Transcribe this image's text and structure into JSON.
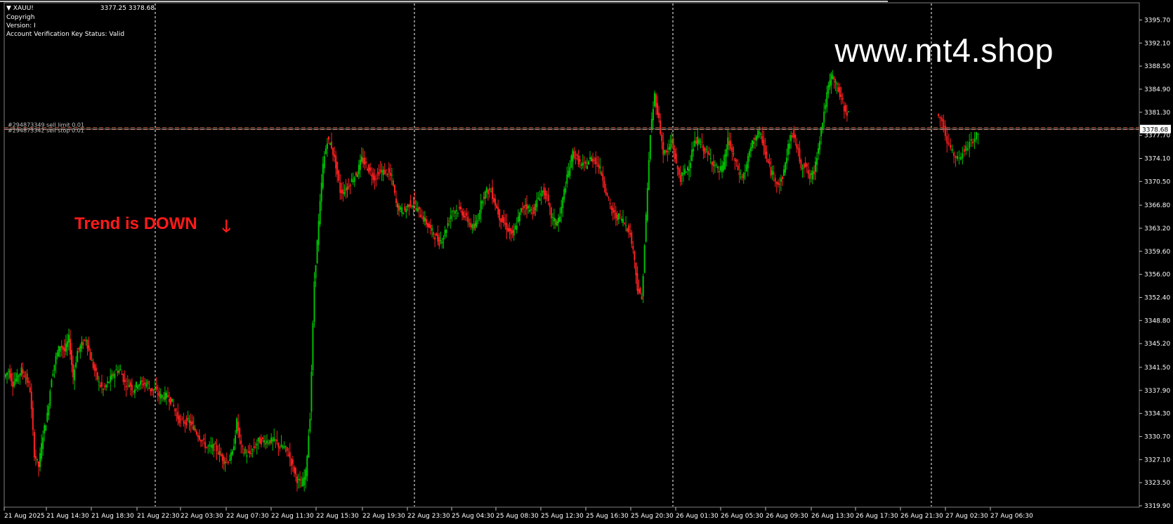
{
  "window": {
    "symbol_menu": "XAUU!",
    "quote_bid_ask": "3377.25 3378.68",
    "copyright_line": "Copyrigh",
    "version_line": "Version: I",
    "verification_line": "Account Verification Key Status: Valid"
  },
  "watermark": "www.mt4.shop",
  "trend_label": "Trend is DOWN",
  "trend_arrow": "🡓",
  "orders": [
    {
      "label": "#294873349 sell limit 0.01",
      "price": 3378.9
    },
    {
      "label": "#294873342 sell stop 0.01",
      "price": 3378.6
    }
  ],
  "current_price_label": "3378.68",
  "current_price": 3378.68,
  "colors": {
    "background": "#000000",
    "bull_candle": "#00c000",
    "bear_candle": "#ff2020",
    "order_line": "#c06040",
    "grid_line": "#ffffff",
    "price_marker": "#ffffff"
  },
  "price_axis": {
    "labels": [
      "3395.70",
      "3392.10",
      "3388.50",
      "3384.90",
      "3381.30",
      "3377.70",
      "3374.10",
      "3370.50",
      "3366.80",
      "3363.20",
      "3359.60",
      "3356.00",
      "3352.40",
      "3348.80",
      "3345.20",
      "3341.50",
      "3337.90",
      "3334.30",
      "3330.70",
      "3327.10",
      "3323.50",
      "3319.90"
    ]
  },
  "time_axis": {
    "labels": [
      "21 Aug 2025",
      "21 Aug 14:30",
      "21 Aug 18:30",
      "21 Aug 22:30",
      "22 Aug 03:30",
      "22 Aug 07:30",
      "22 Aug 11:30",
      "22 Aug 15:30",
      "22 Aug 19:30",
      "22 Aug 23:30",
      "25 Aug 04:30",
      "25 Aug 08:30",
      "25 Aug 12:30",
      "25 Aug 16:30",
      "25 Aug 20:30",
      "26 Aug 01:30",
      "26 Aug 05:30",
      "26 Aug 09:30",
      "26 Aug 13:30",
      "26 Aug 17:30",
      "26 Aug 21:30",
      "27 Aug 02:30",
      "27 Aug 06:30"
    ]
  },
  "chart_data": {
    "type": "candlestick",
    "ylim": [
      3319.9,
      3397.5
    ],
    "price_path": [
      3340,
      3341,
      3339,
      3340,
      3341,
      3340,
      3338,
      3328,
      3326,
      3331,
      3334,
      3340,
      3343,
      3345,
      3344,
      3346,
      3340,
      3344,
      3345,
      3346,
      3343,
      3341,
      3339,
      3338,
      3339,
      3340,
      3341,
      3341,
      3339,
      3339,
      3338,
      3339,
      3339,
      3339,
      3338,
      3338,
      3337,
      3337,
      3337,
      3336,
      3334,
      3333,
      3333,
      3333,
      3332,
      3331,
      3330,
      3329,
      3329,
      3329,
      3328,
      3327,
      3327,
      3328,
      3333,
      3329,
      3328,
      3328,
      3329,
      3330,
      3330,
      3330,
      3330,
      3330,
      3329,
      3329,
      3328,
      3326,
      3324,
      3323,
      3325,
      3334,
      3355,
      3364,
      3373,
      3377,
      3376,
      3373,
      3369,
      3369,
      3370,
      3371,
      3372,
      3374,
      3373,
      3372,
      3371,
      3372,
      3372,
      3372,
      3371,
      3367,
      3366,
      3366,
      3367,
      3367,
      3366,
      3365,
      3364,
      3363,
      3362,
      3361,
      3362,
      3364,
      3366,
      3366,
      3366,
      3365,
      3364,
      3363,
      3365,
      3368,
      3369,
      3369,
      3367,
      3365,
      3364,
      3363,
      3362,
      3364,
      3366,
      3367,
      3366,
      3366,
      3368,
      3369,
      3368,
      3365,
      3364,
      3365,
      3369,
      3372,
      3375,
      3374,
      3373,
      3373,
      3374,
      3374,
      3373,
      3371,
      3368,
      3366,
      3365,
      3365,
      3364,
      3363,
      3360,
      3354,
      3352,
      3365,
      3378,
      3384,
      3380,
      3375,
      3375,
      3377,
      3373,
      3371,
      3372,
      3373,
      3376,
      3377,
      3376,
      3375,
      3374,
      3373,
      3372,
      3373,
      3377,
      3375,
      3373,
      3371,
      3372,
      3375,
      3377,
      3378,
      3377,
      3374,
      3372,
      3371,
      3370,
      3372,
      3376,
      3378,
      3376,
      3373,
      3373,
      3371,
      3372,
      3376,
      3380,
      3384,
      3387,
      3386,
      3384,
      3382,
      3381
    ],
    "gap_x": [
      1210,
      1328
    ],
    "late_path": [
      3381,
      3380,
      3377,
      3375,
      3374,
      3375,
      3376,
      3377,
      3378
    ]
  }
}
